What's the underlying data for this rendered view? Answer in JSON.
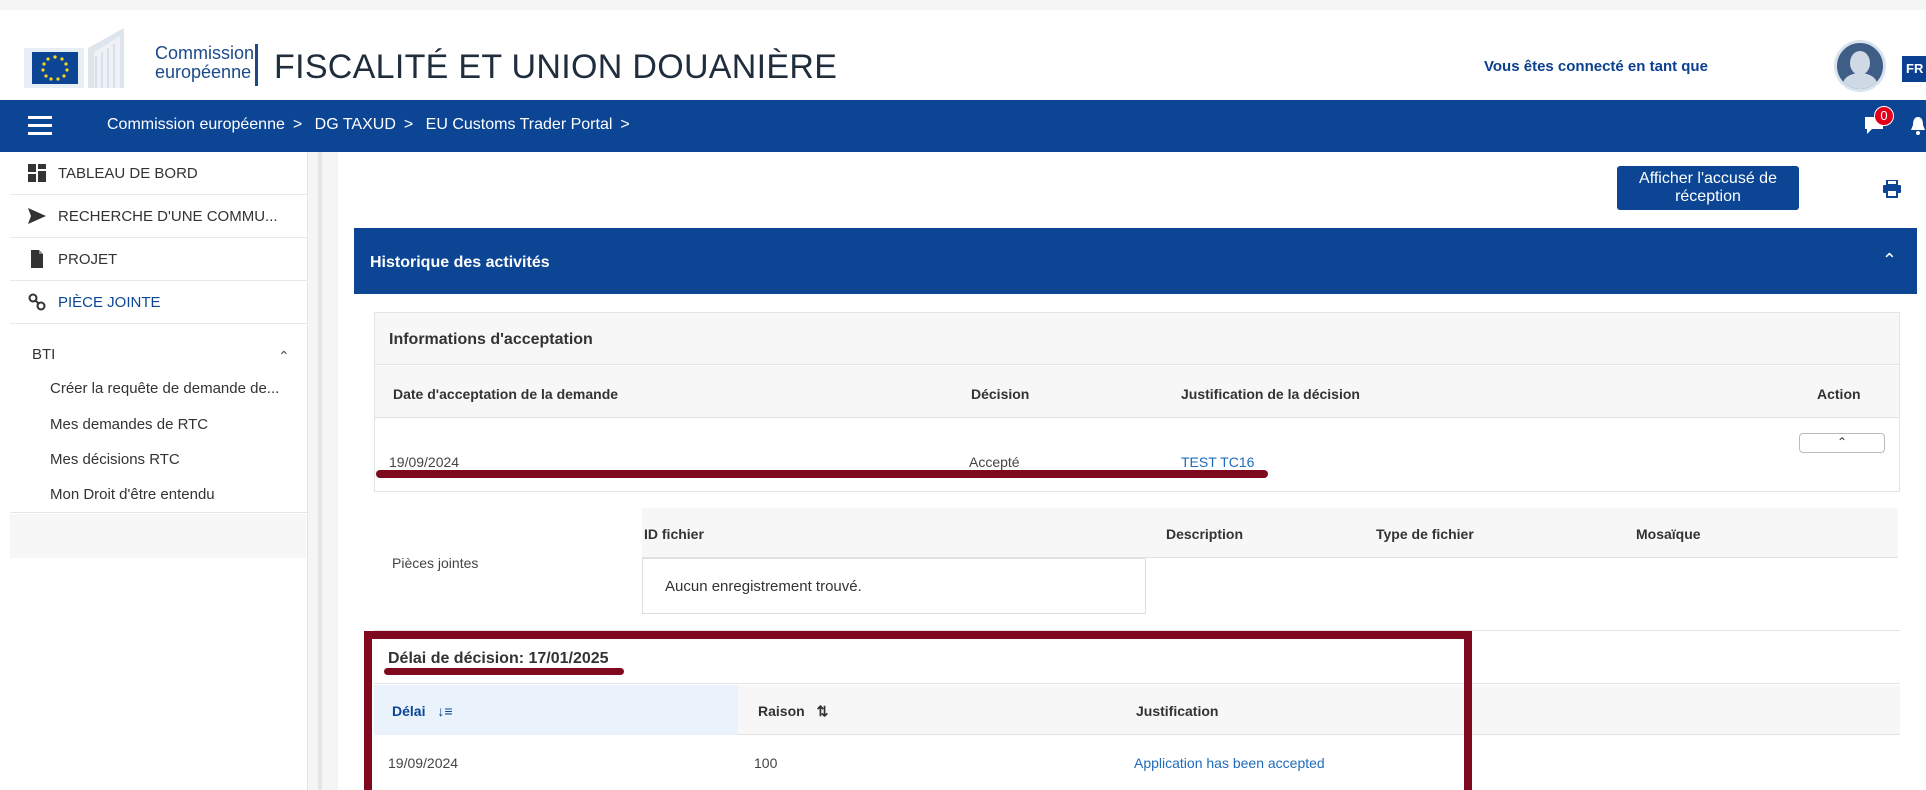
{
  "header": {
    "logo_line1": "Commission",
    "logo_line2": "européenne",
    "app_title": "FISCALITÉ ET UNION DOUANIÈRE",
    "logged_in_text": "Vous êtes connecté en tant que",
    "language": "FR"
  },
  "nav": {
    "breadcrumbs": [
      "Commission européenne",
      "DG TAXUD",
      "EU Customs Trader Portal"
    ],
    "notification_count": "0"
  },
  "sidebar": {
    "items": [
      {
        "label": "TABLEAU DE BORD",
        "icon": "dashboard-icon"
      },
      {
        "label": "RECHERCHE D'UNE COMMU...",
        "icon": "send-icon"
      },
      {
        "label": "PROJET",
        "icon": "document-icon"
      },
      {
        "label": "PIÈCE JOINTE",
        "icon": "link-icon"
      }
    ],
    "group_label": "BTI",
    "sub_items": [
      "Créer la requête de demande de...",
      "Mes demandes de RTC",
      "Mes décisions RTC",
      "Mon Droit d'être entendu"
    ]
  },
  "main": {
    "receipt_button": "Afficher l'accusé de réception",
    "history_title": "Historique des activités",
    "acceptance": {
      "title": "Informations d'acceptation",
      "columns": [
        "Date d'acceptation de la demande",
        "Décision",
        "Justification de la décision",
        "Action"
      ],
      "row": {
        "date": "19/09/2024",
        "decision": "Accepté",
        "justification": "TEST TC16"
      }
    },
    "attachments": {
      "label": "Pièces jointes",
      "columns": [
        "ID fichier",
        "Description",
        "Type de fichier",
        "Mosaïque"
      ],
      "empty_text": "Aucun enregistrement trouvé."
    },
    "deadline": {
      "title": "Délai de décision: 17/01/2025",
      "columns": [
        "Délai",
        "Raison",
        "Justification"
      ],
      "row": {
        "delai": "19/09/2024",
        "raison": "100",
        "justification": "Application has been accepted"
      }
    }
  },
  "colors": {
    "primary": "#0b4594",
    "annotation": "#7f0a1f",
    "link": "#1e6bbd"
  }
}
